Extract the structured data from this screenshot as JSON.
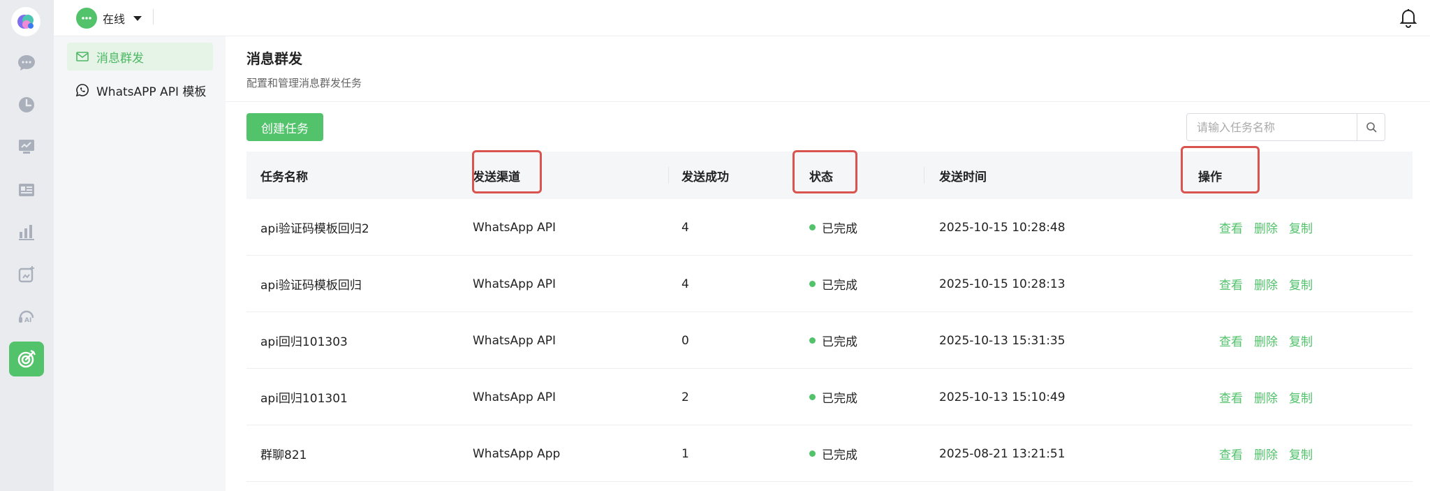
{
  "topbar": {
    "status_text": "在线"
  },
  "subnav": {
    "items": [
      {
        "label": "消息群发",
        "icon": "mail-icon"
      },
      {
        "label": "WhatsAPP API 模板",
        "icon": "whatsapp-icon"
      }
    ]
  },
  "page": {
    "title": "消息群发",
    "subtitle": "配置和管理消息群发任务"
  },
  "toolbar": {
    "create_label": "创建任务",
    "search_placeholder": "请输入任务名称"
  },
  "table": {
    "headers": {
      "name": "任务名称",
      "channel": "发送渠道",
      "success": "发送成功",
      "status": "状态",
      "time": "发送时间",
      "actions": "操作"
    },
    "rows": [
      {
        "name": "api验证码模板回归2",
        "channel": "WhatsApp API",
        "success": "4",
        "status": "已完成",
        "time": "2025-10-15 10:28:48"
      },
      {
        "name": "api验证码模板回归",
        "channel": "WhatsApp API",
        "success": "4",
        "status": "已完成",
        "time": "2025-10-15 10:28:13"
      },
      {
        "name": "api回归101303",
        "channel": "WhatsApp API",
        "success": "0",
        "status": "已完成",
        "time": "2025-10-13 15:31:35"
      },
      {
        "name": "api回归101301",
        "channel": "WhatsApp API",
        "success": "2",
        "status": "已完成",
        "time": "2025-10-13 15:10:49"
      },
      {
        "name": "群聊821",
        "channel": "WhatsApp App",
        "success": "1",
        "status": "已完成",
        "time": "2025-08-21 13:21:51"
      }
    ],
    "action_labels": {
      "view": "查看",
      "delete": "删除",
      "copy": "复制"
    }
  },
  "colors": {
    "accent": "#52c26b",
    "highlight": "#d9534f"
  }
}
